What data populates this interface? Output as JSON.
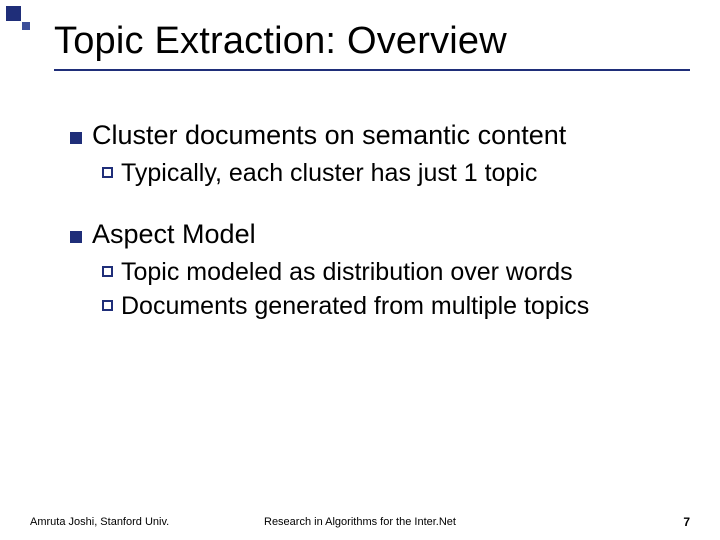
{
  "title": "Topic Extraction: Overview",
  "points": {
    "p1": {
      "text": "Cluster documents on semantic content",
      "subs": {
        "s1": "Typically, each cluster has just 1 topic"
      }
    },
    "p2": {
      "text": "Aspect Model",
      "subs": {
        "s1": "Topic modeled as distribution over words",
        "s2": "Documents generated from multiple topics"
      }
    }
  },
  "footer": {
    "left": "Amruta Joshi, Stanford Univ.",
    "center": "Research in Algorithms for the Inter.Net",
    "right": "7"
  }
}
